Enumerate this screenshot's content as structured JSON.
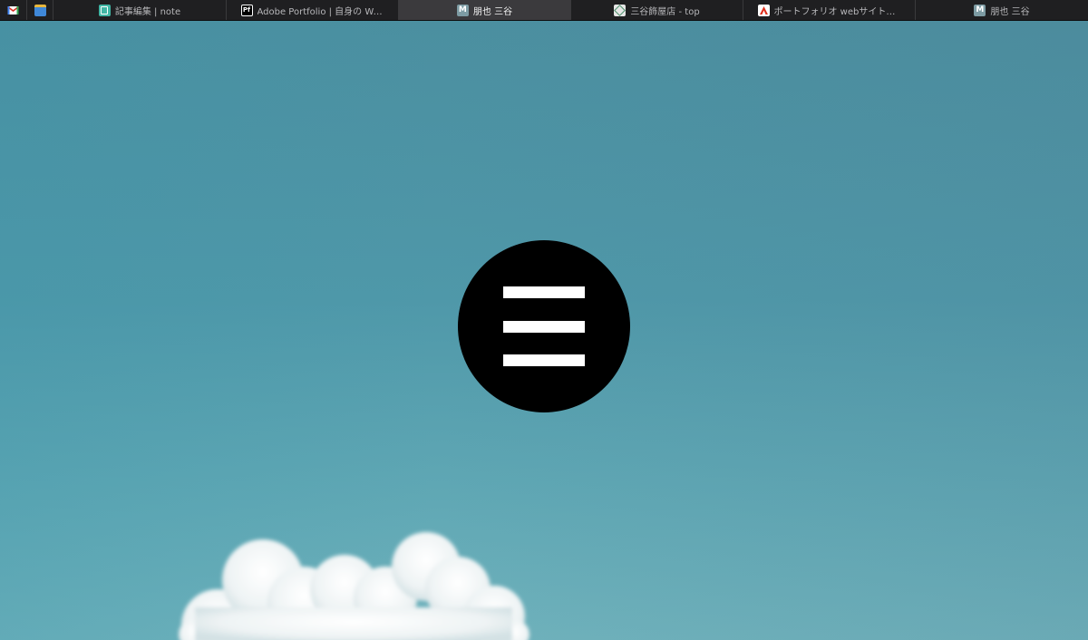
{
  "browser": {
    "pinned_tabs": [
      {
        "icon": "gmail-icon"
      },
      {
        "icon": "calendar-icon"
      }
    ],
    "tabs": [
      {
        "icon": "note-icon",
        "title": "記事編集 | note",
        "active": false
      },
      {
        "icon": "adobe-portfolio-icon",
        "icon_text": "Pf",
        "title": "Adobe Portfolio | 自身の Web…",
        "active": false
      },
      {
        "icon": "m-icon",
        "icon_text": "M",
        "title": "朋也 三谷",
        "active": true
      },
      {
        "icon": "shop-icon",
        "title": "三谷飾屋店 - top",
        "active": false
      },
      {
        "icon": "adobe-icon",
        "title": "ポートフォリオ webサイトの作成…",
        "active": false
      },
      {
        "icon": "m-icon",
        "icon_text": "M",
        "title": "朋也 三谷",
        "active": false
      }
    ]
  },
  "page": {
    "menu_button": {
      "icon": "hamburger-menu-icon"
    }
  },
  "colors": {
    "sky_top": "#4b8fa0",
    "sky_bottom": "#6fb2bc",
    "menu_circle": "#000000",
    "menu_bars": "#ffffff",
    "tabbar": "#1f1f21",
    "active_tab": "#3b3a3d"
  }
}
